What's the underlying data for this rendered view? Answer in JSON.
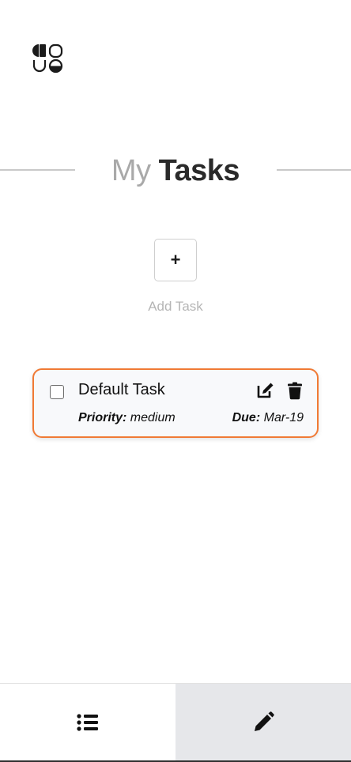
{
  "app": {
    "logo_icon": "quadrant-logo-icon"
  },
  "header": {
    "title_light": "My",
    "title_bold": "Tasks"
  },
  "add_task": {
    "button_label": "+",
    "label": "Add Task"
  },
  "tasks": [
    {
      "name": "Default Task",
      "completed": false,
      "priority_label": "Priority:",
      "priority_value": "medium",
      "due_label": "Due:",
      "due_value": "Mar-19",
      "edit_icon": "edit-icon",
      "delete_icon": "trash-icon"
    }
  ],
  "bottom_nav": {
    "tabs": [
      {
        "icon": "list-icon",
        "active": true
      },
      {
        "icon": "pencil-icon",
        "active": false
      }
    ]
  },
  "colors": {
    "accent": "#f07a35",
    "title_light": "#a9a9a9",
    "title_bold": "#2a2a2a",
    "inactive_tab": "#e6e7ea"
  }
}
